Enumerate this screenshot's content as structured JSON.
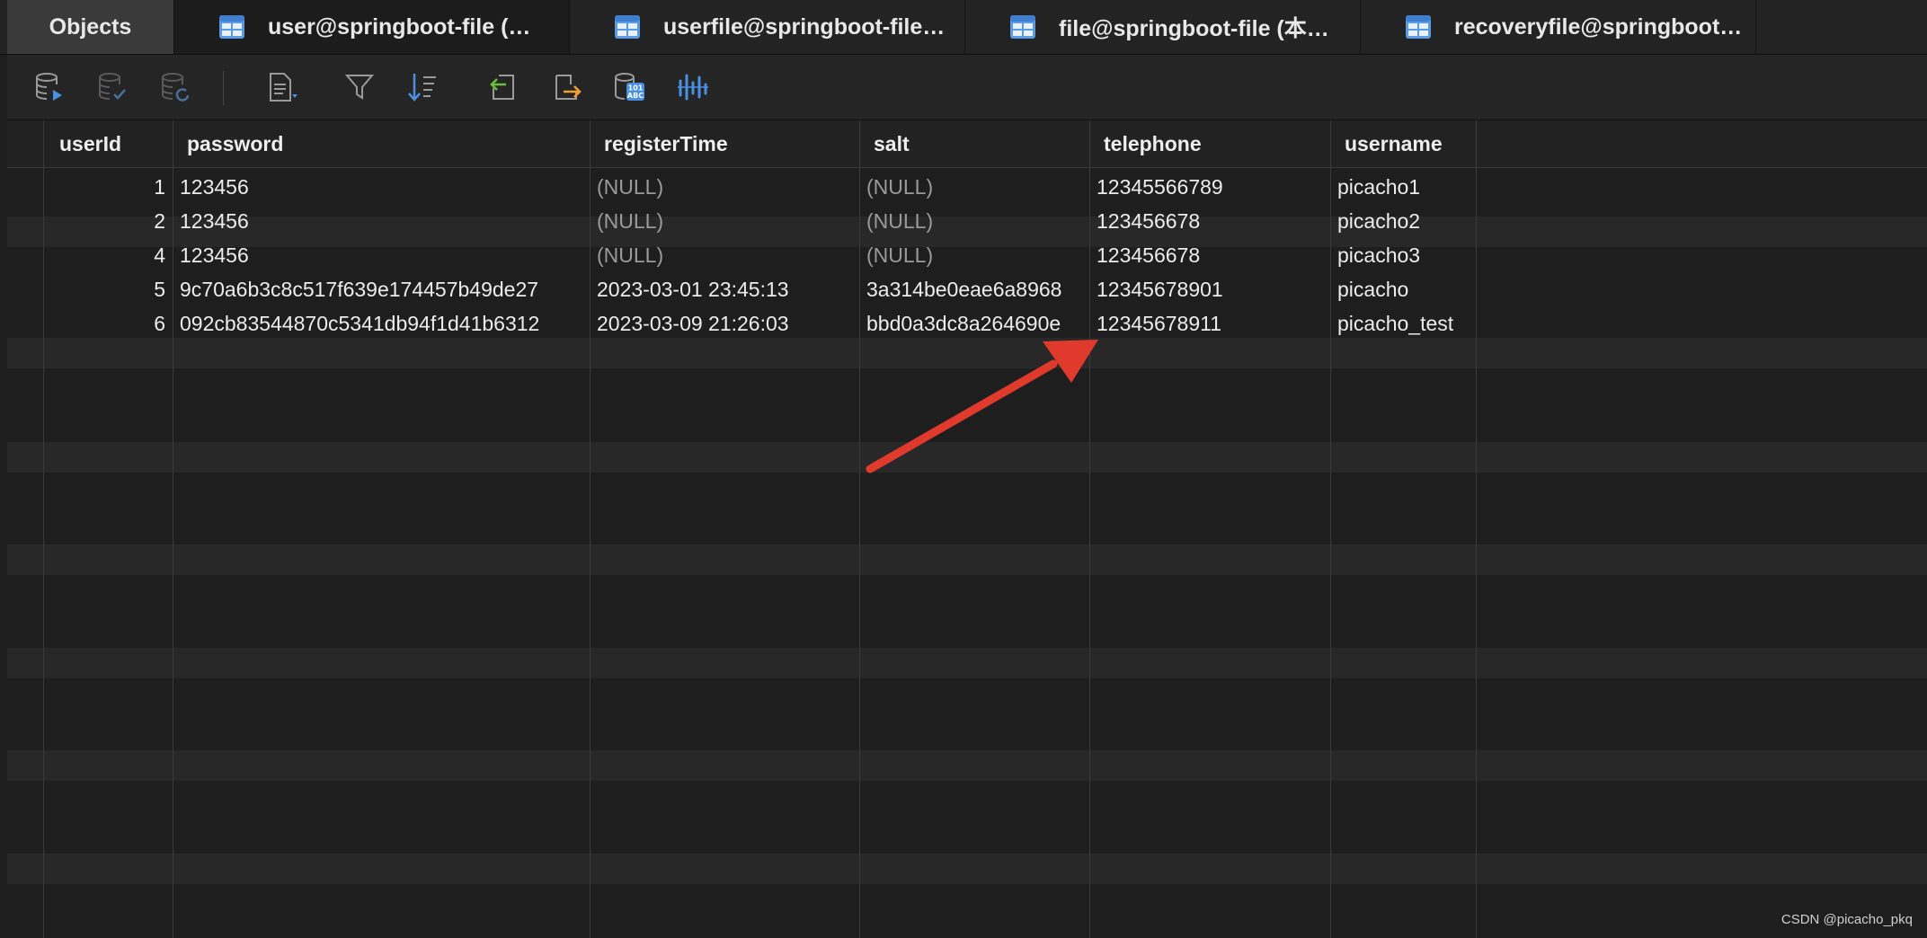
{
  "tabs": [
    {
      "label": "Objects",
      "icon": "none"
    },
    {
      "label": "user@springboot-file (…",
      "icon": "table-icon"
    },
    {
      "label": "userfile@springboot-file…",
      "icon": "table-icon"
    },
    {
      "label": "file@springboot-file (本…",
      "icon": "table-icon"
    },
    {
      "label": "recoveryfile@springboot…",
      "icon": "table-icon"
    }
  ],
  "toolbar": {
    "icons": [
      "database-run-icon",
      "database-commit-icon",
      "database-refresh-icon",
      "document-dropdown-icon",
      "filter-icon",
      "sort-icon",
      "import-icon",
      "export-icon",
      "data-generation-icon",
      "chart-icon"
    ]
  },
  "grid": {
    "columns": [
      "userId",
      "password",
      "registerTime",
      "salt",
      "telephone",
      "username"
    ],
    "rows": [
      [
        "1",
        "123456",
        "(NULL)",
        "(NULL)",
        "12345566789",
        "picacho1"
      ],
      [
        "2",
        "123456",
        "(NULL)",
        "(NULL)",
        "123456678",
        "picacho2"
      ],
      [
        "4",
        "123456",
        "(NULL)",
        "(NULL)",
        "123456678",
        "picacho3"
      ],
      [
        "5",
        "9c70a6b3c8c517f639e174457b49de27",
        "2023-03-01 23:45:13",
        "3a314be0eae6a8968",
        "12345678901",
        "picacho"
      ],
      [
        "6",
        "092cb83544870c5341db94f1d41b6312",
        "2023-03-09 21:26:03",
        "bbd0a3dc8a264690e",
        "12345678911",
        "picacho_test"
      ]
    ]
  },
  "colors": {
    "accent": "#4a90e2",
    "annotation_arrow": "#e03a2c",
    "background": "#1e1e1e"
  },
  "watermark": "CSDN @picacho_pkq"
}
